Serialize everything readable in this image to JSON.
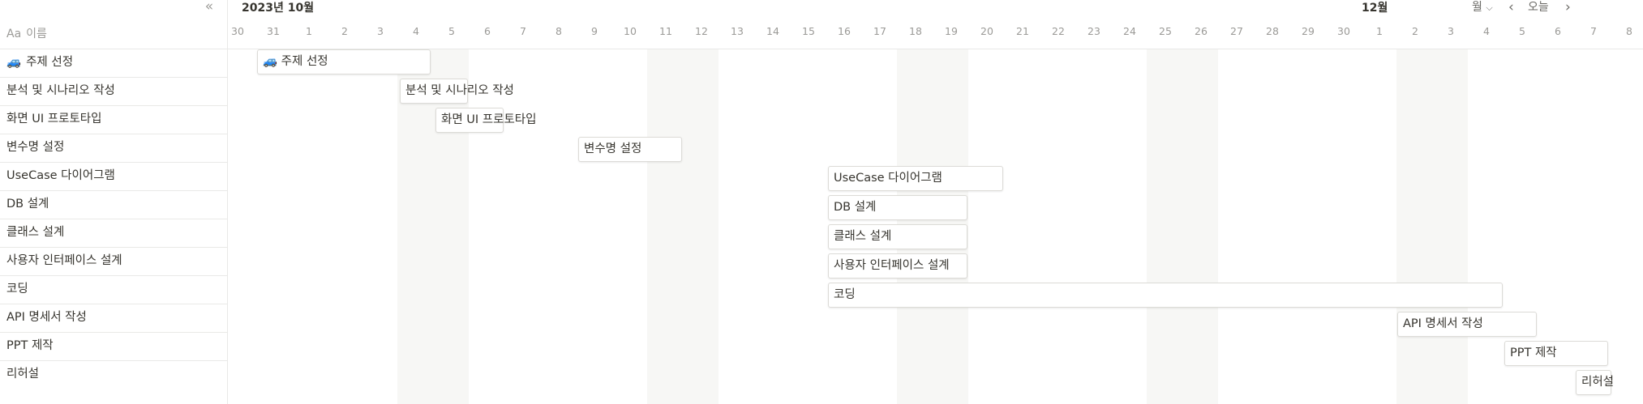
{
  "left_panel": {
    "collapse_icon": "«",
    "name_header": {
      "icon_text": "Aa",
      "label": "이름"
    }
  },
  "header": {
    "month_current": "2023년 10월",
    "month_next": "12월",
    "view_select": "월",
    "today_label": "오늘",
    "chevron_down": "⌵",
    "prev": "‹",
    "next": "›"
  },
  "days": [
    "30",
    "31",
    "1",
    "2",
    "3",
    "4",
    "5",
    "6",
    "7",
    "8",
    "9",
    "10",
    "11",
    "12",
    "13",
    "14",
    "15",
    "16",
    "17",
    "18",
    "19",
    "20",
    "21",
    "22",
    "23",
    "24",
    "25",
    "26",
    "27",
    "28",
    "29",
    "30",
    "1",
    "2",
    "3",
    "4",
    "5",
    "6",
    "7",
    "8"
  ],
  "tasks": [
    {
      "label": "주제 선정",
      "emoji": "🚙"
    },
    {
      "label": "분석 및 시나리오 작성"
    },
    {
      "label": "화면 UI 프로토타입"
    },
    {
      "label": "변수명 설정"
    },
    {
      "label": "UseCase 다이어그램"
    },
    {
      "label": "DB 설계"
    },
    {
      "label": "클래스 설계"
    },
    {
      "label": "사용자 인터페이스 설계"
    },
    {
      "label": "코딩"
    },
    {
      "label": "API 명세서 작성"
    },
    {
      "label": "PPT 제작"
    },
    {
      "label": "리허설"
    }
  ]
}
